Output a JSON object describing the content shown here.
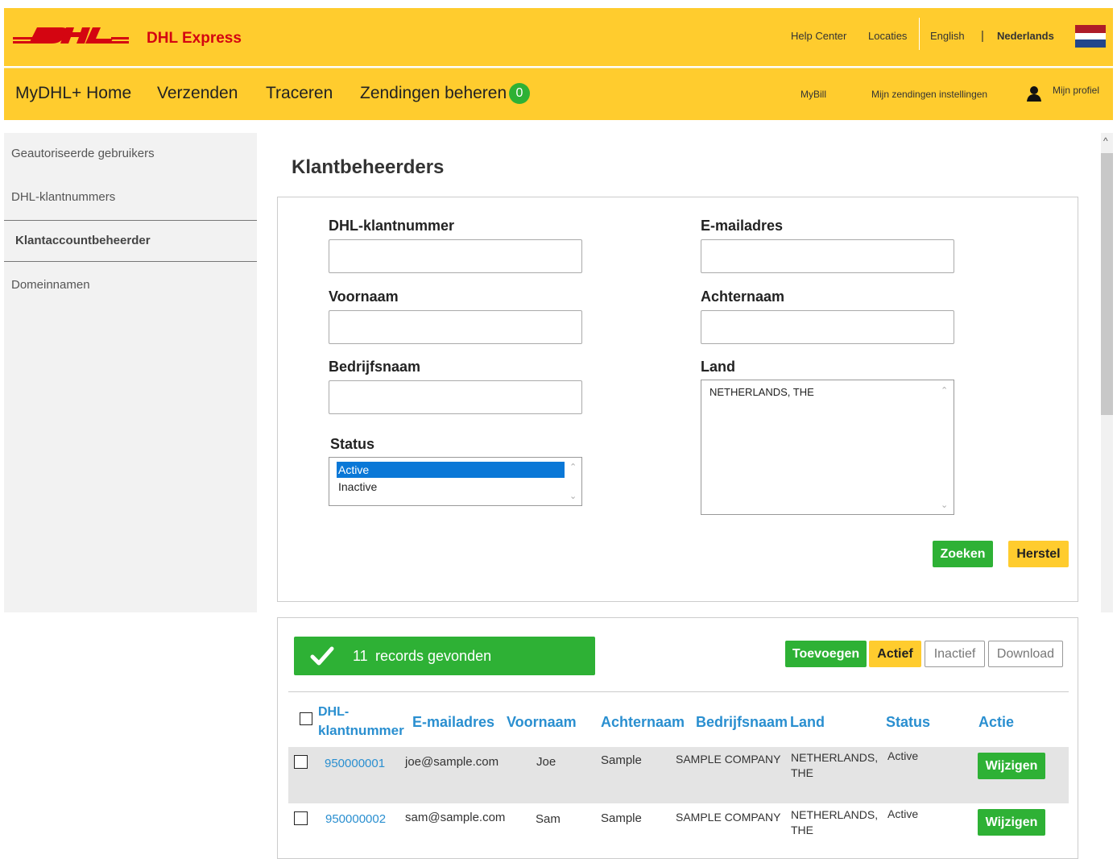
{
  "header": {
    "brand": "DHL Express",
    "links": {
      "help": "Help Center",
      "locations": "Locaties",
      "english": "English",
      "separator": "|",
      "dutch": "Nederlands"
    },
    "flag_icon": "netherlands-flag-icon"
  },
  "nav": {
    "home": "MyDHL+ Home",
    "send": "Verzenden",
    "track": "Traceren",
    "manage": "Zendingen beheren",
    "manage_badge": "0",
    "mybill": "MyBill",
    "settings": "Mijn zendingen instellingen",
    "profile": "Mijn profiel"
  },
  "sidebar": {
    "items": [
      {
        "label": "Geautoriseerde gebruikers"
      },
      {
        "label": "DHL-klantnummers"
      },
      {
        "label": "Klantaccountbeheerder"
      },
      {
        "label": "Domeinnamen"
      }
    ]
  },
  "page": {
    "title": "Klantbeheerders"
  },
  "form": {
    "account_label": "DHL-klantnummer",
    "email_label": "E-mailadres",
    "firstname_label": "Voornaam",
    "lastname_label": "Achternaam",
    "company_label": "Bedrijfsnaam",
    "country_label": "Land",
    "country_value": "NETHERLANDS, THE",
    "status_label": "Status",
    "status_options": [
      "Active",
      "Inactive"
    ],
    "search_button": "Zoeken",
    "reset_button": "Herstel"
  },
  "results": {
    "count": "11",
    "count_text": "records gevonden",
    "add_button": "Toevoegen",
    "active_button": "Actief",
    "inactive_button": "Inactief",
    "download_button": "Download",
    "columns": {
      "account_line1": "DHL-",
      "account_line2": "klantnummer",
      "email": "E-mailadres",
      "firstname": "Voornaam",
      "lastname": "Achternaam",
      "company": "Bedrijfsnaam",
      "country": "Land",
      "status": "Status",
      "action": "Actie"
    },
    "rows": [
      {
        "account": "950000001",
        "email": "joe@sample.com",
        "firstname": "Joe",
        "lastname": "Sample",
        "company": "SAMPLE COMPANY",
        "country_line1": "NETHERLANDS,",
        "country_line2": "THE",
        "status": "Active",
        "action": "Wijzigen"
      },
      {
        "account": "950000002",
        "email": "sam@sample.com",
        "firstname": "Sam",
        "lastname": "Sample",
        "company": "SAMPLE COMPANY",
        "country_line1": "NETHERLANDS,",
        "country_line2": "THE",
        "status": "Active",
        "action": "Wijzigen"
      }
    ]
  },
  "colors": {
    "brand_yellow": "#ffcc2e",
    "brand_red": "#d40511",
    "success_green": "#2eb135",
    "link_blue": "#2a8fd0"
  }
}
